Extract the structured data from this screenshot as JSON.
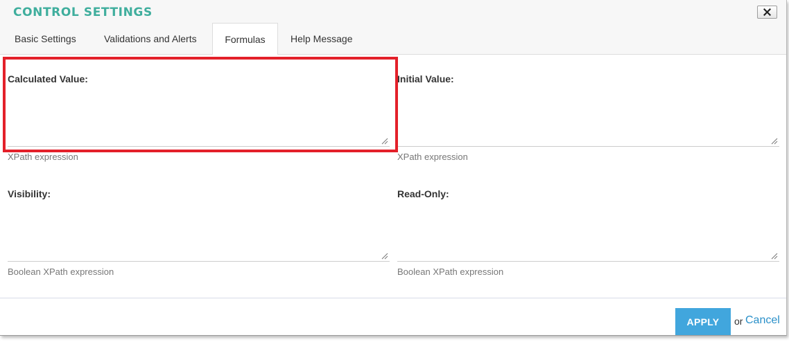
{
  "dialog": {
    "title": "CONTROL SETTINGS",
    "close_icon": "close-x-icon"
  },
  "tabs": [
    {
      "label": "Basic Settings",
      "active": false
    },
    {
      "label": "Validations and Alerts",
      "active": false
    },
    {
      "label": "Formulas",
      "active": true
    },
    {
      "label": "Help Message",
      "active": false
    }
  ],
  "fields": {
    "calculated_value": {
      "label": "Calculated Value:",
      "value": "",
      "hint": "XPath expression"
    },
    "initial_value": {
      "label": "Initial Value:",
      "value": "",
      "hint": "XPath expression"
    },
    "visibility": {
      "label": "Visibility:",
      "value": "",
      "hint": "Boolean XPath expression"
    },
    "read_only": {
      "label": "Read-Only:",
      "value": "",
      "hint": "Boolean XPath expression"
    }
  },
  "highlight": {
    "target": "calculated_value",
    "color": "#e3202a"
  },
  "footer": {
    "apply_label": "APPLY",
    "or_text": "or",
    "cancel_label": "Cancel"
  },
  "colors": {
    "title": "#3fae9d",
    "apply_button": "#41a6dd",
    "cancel_link": "#2a90c9"
  }
}
